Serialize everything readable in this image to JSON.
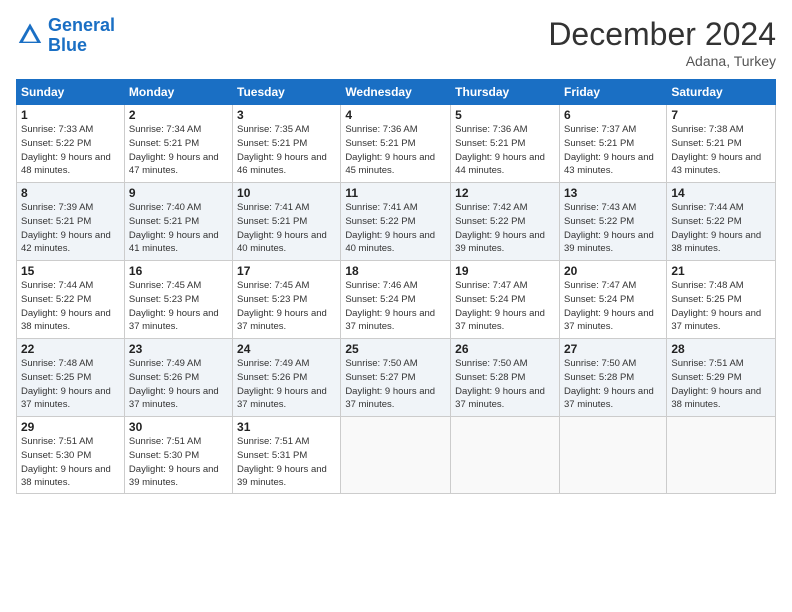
{
  "header": {
    "logo_general": "General",
    "logo_blue": "Blue",
    "month": "December 2024",
    "location": "Adana, Turkey"
  },
  "days_of_week": [
    "Sunday",
    "Monday",
    "Tuesday",
    "Wednesday",
    "Thursday",
    "Friday",
    "Saturday"
  ],
  "weeks": [
    [
      {
        "day": "1",
        "sunrise": "Sunrise: 7:33 AM",
        "sunset": "Sunset: 5:22 PM",
        "daylight": "Daylight: 9 hours and 48 minutes."
      },
      {
        "day": "2",
        "sunrise": "Sunrise: 7:34 AM",
        "sunset": "Sunset: 5:21 PM",
        "daylight": "Daylight: 9 hours and 47 minutes."
      },
      {
        "day": "3",
        "sunrise": "Sunrise: 7:35 AM",
        "sunset": "Sunset: 5:21 PM",
        "daylight": "Daylight: 9 hours and 46 minutes."
      },
      {
        "day": "4",
        "sunrise": "Sunrise: 7:36 AM",
        "sunset": "Sunset: 5:21 PM",
        "daylight": "Daylight: 9 hours and 45 minutes."
      },
      {
        "day": "5",
        "sunrise": "Sunrise: 7:36 AM",
        "sunset": "Sunset: 5:21 PM",
        "daylight": "Daylight: 9 hours and 44 minutes."
      },
      {
        "day": "6",
        "sunrise": "Sunrise: 7:37 AM",
        "sunset": "Sunset: 5:21 PM",
        "daylight": "Daylight: 9 hours and 43 minutes."
      },
      {
        "day": "7",
        "sunrise": "Sunrise: 7:38 AM",
        "sunset": "Sunset: 5:21 PM",
        "daylight": "Daylight: 9 hours and 43 minutes."
      }
    ],
    [
      {
        "day": "8",
        "sunrise": "Sunrise: 7:39 AM",
        "sunset": "Sunset: 5:21 PM",
        "daylight": "Daylight: 9 hours and 42 minutes."
      },
      {
        "day": "9",
        "sunrise": "Sunrise: 7:40 AM",
        "sunset": "Sunset: 5:21 PM",
        "daylight": "Daylight: 9 hours and 41 minutes."
      },
      {
        "day": "10",
        "sunrise": "Sunrise: 7:41 AM",
        "sunset": "Sunset: 5:21 PM",
        "daylight": "Daylight: 9 hours and 40 minutes."
      },
      {
        "day": "11",
        "sunrise": "Sunrise: 7:41 AM",
        "sunset": "Sunset: 5:22 PM",
        "daylight": "Daylight: 9 hours and 40 minutes."
      },
      {
        "day": "12",
        "sunrise": "Sunrise: 7:42 AM",
        "sunset": "Sunset: 5:22 PM",
        "daylight": "Daylight: 9 hours and 39 minutes."
      },
      {
        "day": "13",
        "sunrise": "Sunrise: 7:43 AM",
        "sunset": "Sunset: 5:22 PM",
        "daylight": "Daylight: 9 hours and 39 minutes."
      },
      {
        "day": "14",
        "sunrise": "Sunrise: 7:44 AM",
        "sunset": "Sunset: 5:22 PM",
        "daylight": "Daylight: 9 hours and 38 minutes."
      }
    ],
    [
      {
        "day": "15",
        "sunrise": "Sunrise: 7:44 AM",
        "sunset": "Sunset: 5:22 PM",
        "daylight": "Daylight: 9 hours and 38 minutes."
      },
      {
        "day": "16",
        "sunrise": "Sunrise: 7:45 AM",
        "sunset": "Sunset: 5:23 PM",
        "daylight": "Daylight: 9 hours and 37 minutes."
      },
      {
        "day": "17",
        "sunrise": "Sunrise: 7:45 AM",
        "sunset": "Sunset: 5:23 PM",
        "daylight": "Daylight: 9 hours and 37 minutes."
      },
      {
        "day": "18",
        "sunrise": "Sunrise: 7:46 AM",
        "sunset": "Sunset: 5:24 PM",
        "daylight": "Daylight: 9 hours and 37 minutes."
      },
      {
        "day": "19",
        "sunrise": "Sunrise: 7:47 AM",
        "sunset": "Sunset: 5:24 PM",
        "daylight": "Daylight: 9 hours and 37 minutes."
      },
      {
        "day": "20",
        "sunrise": "Sunrise: 7:47 AM",
        "sunset": "Sunset: 5:24 PM",
        "daylight": "Daylight: 9 hours and 37 minutes."
      },
      {
        "day": "21",
        "sunrise": "Sunrise: 7:48 AM",
        "sunset": "Sunset: 5:25 PM",
        "daylight": "Daylight: 9 hours and 37 minutes."
      }
    ],
    [
      {
        "day": "22",
        "sunrise": "Sunrise: 7:48 AM",
        "sunset": "Sunset: 5:25 PM",
        "daylight": "Daylight: 9 hours and 37 minutes."
      },
      {
        "day": "23",
        "sunrise": "Sunrise: 7:49 AM",
        "sunset": "Sunset: 5:26 PM",
        "daylight": "Daylight: 9 hours and 37 minutes."
      },
      {
        "day": "24",
        "sunrise": "Sunrise: 7:49 AM",
        "sunset": "Sunset: 5:26 PM",
        "daylight": "Daylight: 9 hours and 37 minutes."
      },
      {
        "day": "25",
        "sunrise": "Sunrise: 7:50 AM",
        "sunset": "Sunset: 5:27 PM",
        "daylight": "Daylight: 9 hours and 37 minutes."
      },
      {
        "day": "26",
        "sunrise": "Sunrise: 7:50 AM",
        "sunset": "Sunset: 5:28 PM",
        "daylight": "Daylight: 9 hours and 37 minutes."
      },
      {
        "day": "27",
        "sunrise": "Sunrise: 7:50 AM",
        "sunset": "Sunset: 5:28 PM",
        "daylight": "Daylight: 9 hours and 37 minutes."
      },
      {
        "day": "28",
        "sunrise": "Sunrise: 7:51 AM",
        "sunset": "Sunset: 5:29 PM",
        "daylight": "Daylight: 9 hours and 38 minutes."
      }
    ],
    [
      {
        "day": "29",
        "sunrise": "Sunrise: 7:51 AM",
        "sunset": "Sunset: 5:30 PM",
        "daylight": "Daylight: 9 hours and 38 minutes."
      },
      {
        "day": "30",
        "sunrise": "Sunrise: 7:51 AM",
        "sunset": "Sunset: 5:30 PM",
        "daylight": "Daylight: 9 hours and 39 minutes."
      },
      {
        "day": "31",
        "sunrise": "Sunrise: 7:51 AM",
        "sunset": "Sunset: 5:31 PM",
        "daylight": "Daylight: 9 hours and 39 minutes."
      },
      null,
      null,
      null,
      null
    ]
  ]
}
